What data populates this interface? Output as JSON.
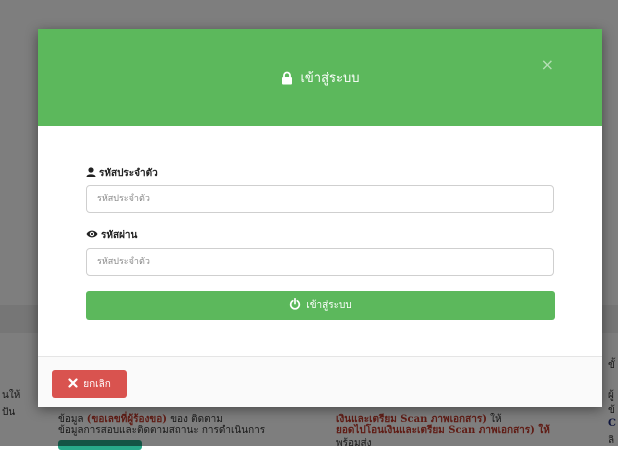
{
  "background": {
    "left_fragments": [
      "นให้",
      "ปัน"
    ],
    "col1_line1_normal": "ข้อมูล",
    "col1_line1_red": "(ขอเลขที่ผู้ร้องขอ)",
    "col1_line1_tail": "ของ ติดตาม",
    "col1_line2": "ข้อมูลการสอบและติดตามสถานะ การดำเนินการ",
    "col2_line1_red": "เงินและเตรียม Scan ภาพเอกสาร)",
    "col2_line1_tail": "ให้",
    "col2_line2": "ยอดไปโอนเงินและเตรียม Scan ภาพเอกสาร) ให้",
    "col2_line3": "พร้อมส่ง",
    "right_fragments": [
      "ขั้",
      "ผู้",
      "ข้",
      "C",
      "ลิ"
    ]
  },
  "modal": {
    "title": "เข้าสู่ระบบ",
    "close_symbol": "×",
    "username": {
      "label": "รหัสประจำตัว",
      "placeholder": "รหัสประจำตัว",
      "value": ""
    },
    "password": {
      "label": "รหัสผ่าน",
      "placeholder": "รหัสประจำตัว",
      "value": ""
    },
    "login_label": "เข้าสู่ระบบ",
    "cancel_label": "ยกเลิก"
  },
  "colors": {
    "header": "#5cb85c",
    "primary_button": "#5cb85c",
    "cancel_button": "#d9534f",
    "overlay": "rgba(0,0,0,0.5)"
  }
}
